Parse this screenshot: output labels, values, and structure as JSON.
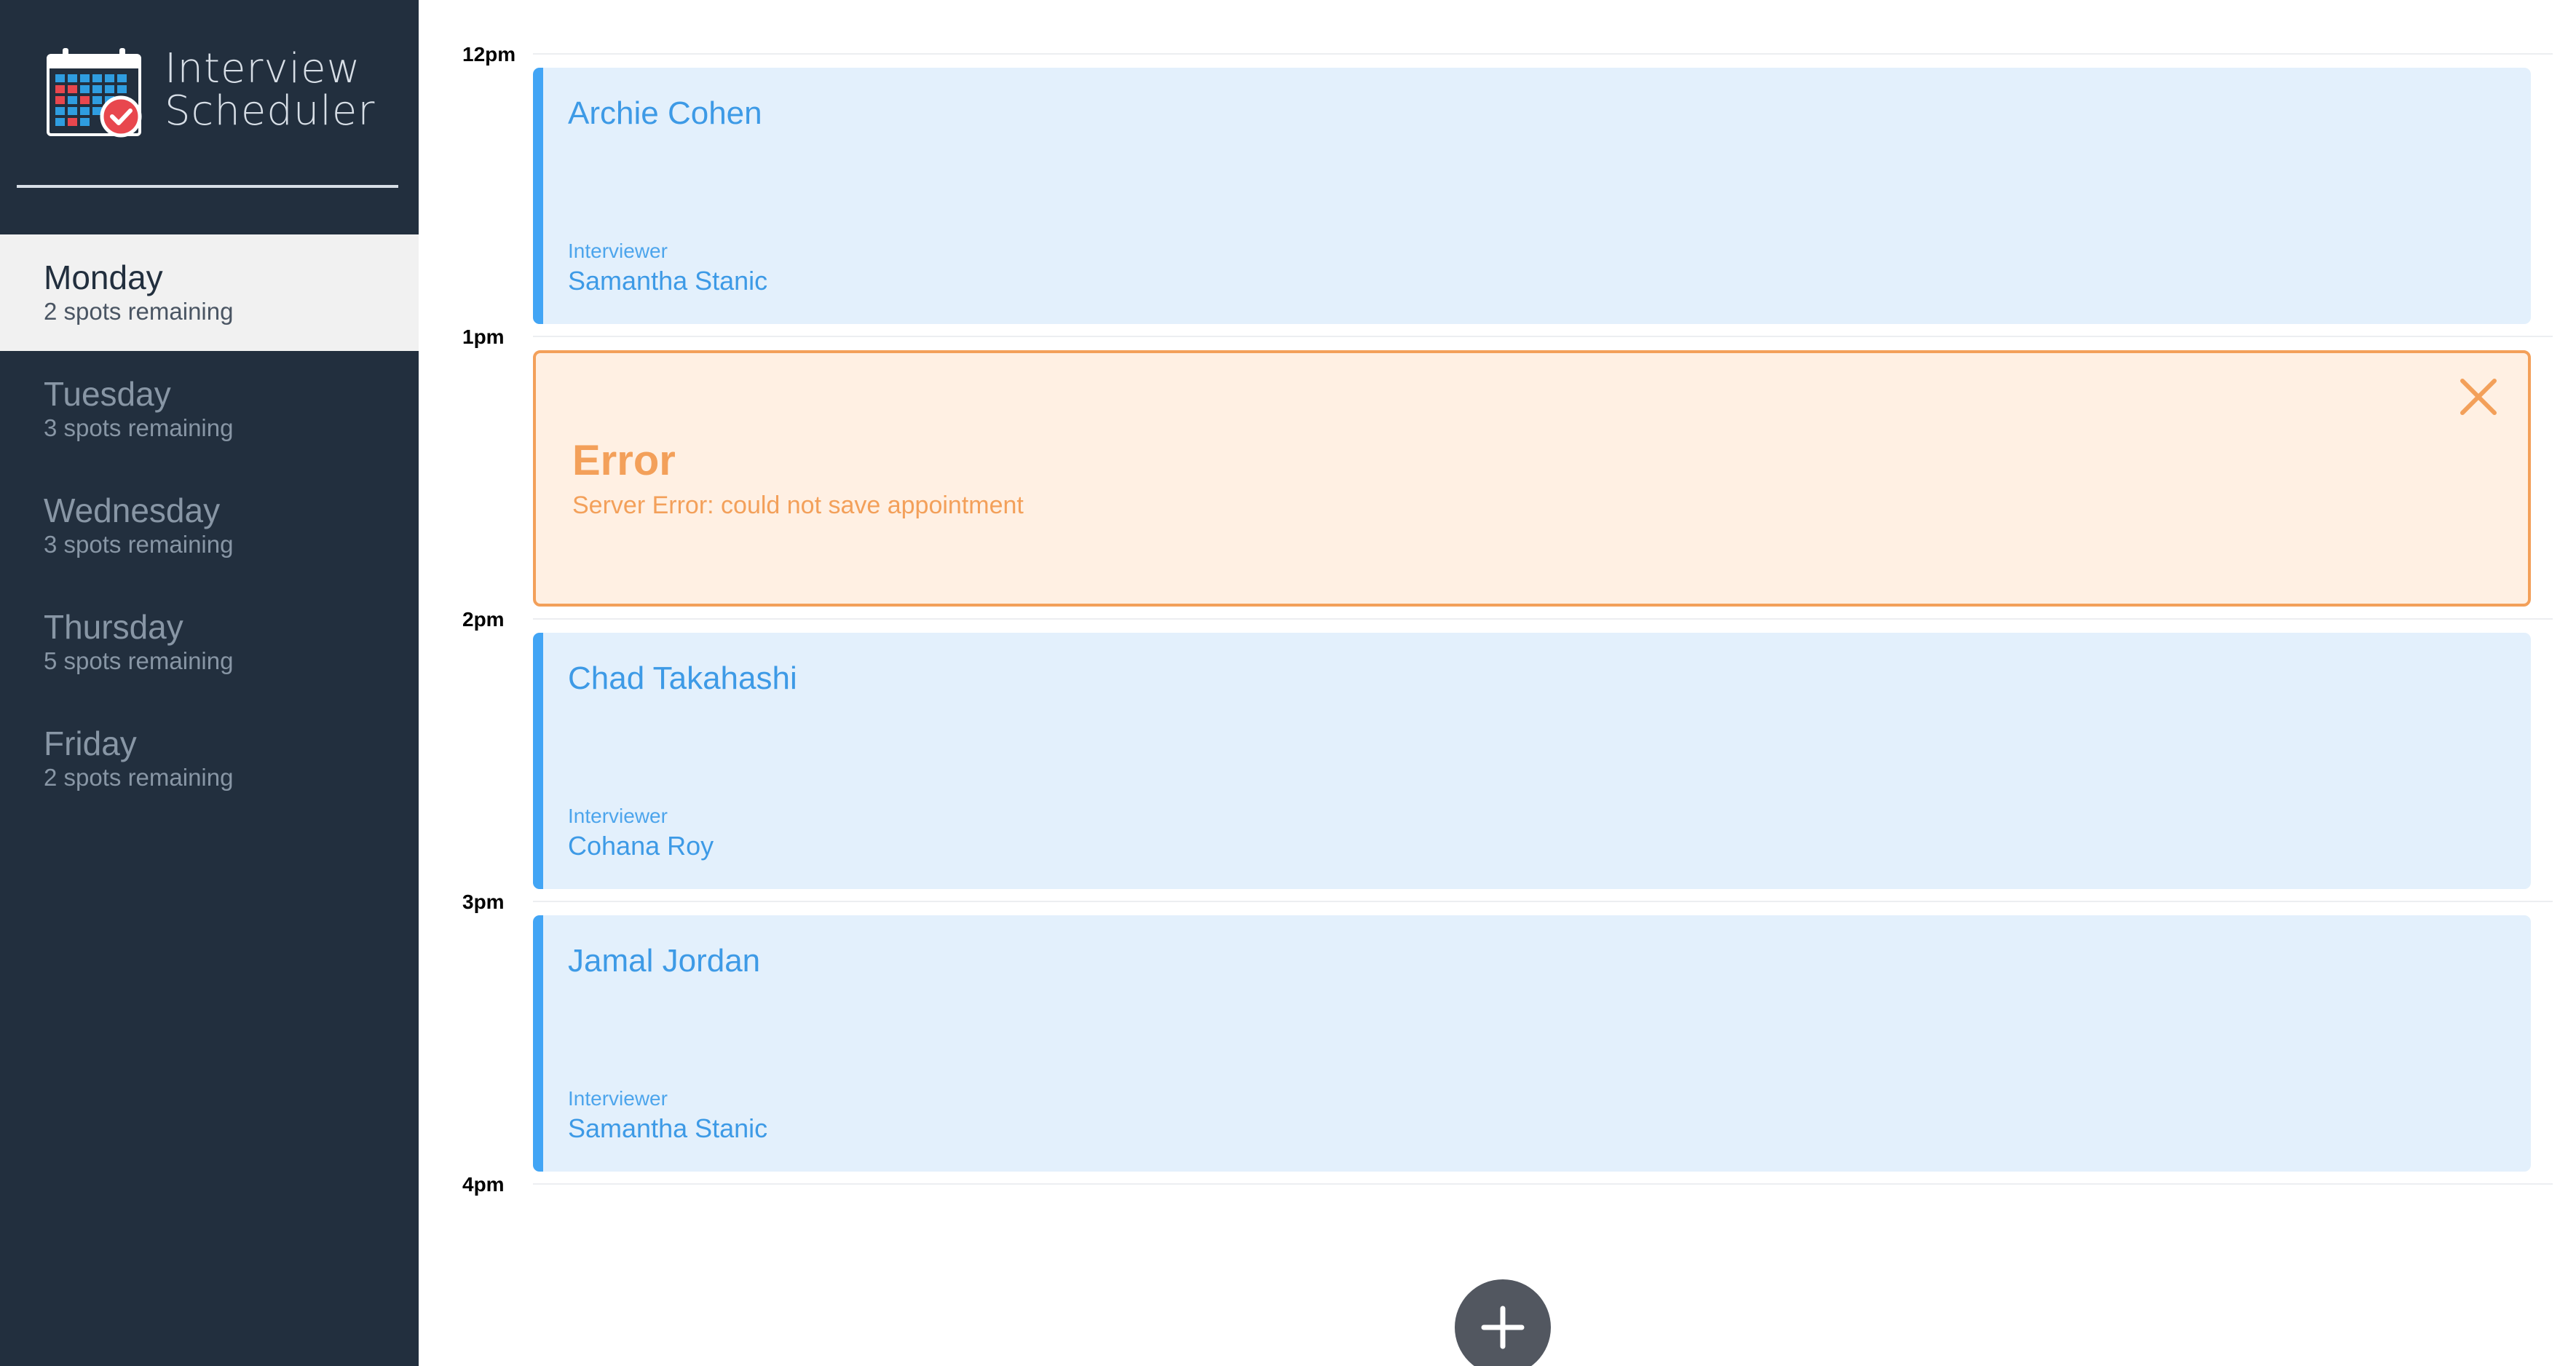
{
  "app": {
    "name_line1": "Interview",
    "name_line2": "Scheduler",
    "logo_icon": "calendar-check-icon"
  },
  "days": [
    {
      "name": "Monday",
      "spots": "2 spots remaining",
      "selected": true
    },
    {
      "name": "Tuesday",
      "spots": "3 spots remaining",
      "selected": false
    },
    {
      "name": "Wednesday",
      "spots": "3 spots remaining",
      "selected": false
    },
    {
      "name": "Thursday",
      "spots": "5 spots remaining",
      "selected": false
    },
    {
      "name": "Friday",
      "spots": "2 spots remaining",
      "selected": false
    }
  ],
  "schedule": {
    "slots": [
      {
        "time": "12pm",
        "student": "Archie Cohen",
        "interviewer_label": "Interviewer",
        "interviewer": "Samantha Stanic"
      },
      {
        "time": "1pm",
        "error": {
          "title": "Error",
          "message": "Server Error: could not save appointment",
          "close_icon": "close-icon"
        }
      },
      {
        "time": "2pm",
        "student": "Chad Takahashi",
        "interviewer_label": "Interviewer",
        "interviewer": "Cohana Roy"
      },
      {
        "time": "3pm",
        "student": "Jamal Jordan",
        "interviewer_label": "Interviewer",
        "interviewer": "Samantha Stanic"
      }
    ],
    "end_time": "4pm",
    "add_icon": "plus-icon"
  },
  "colors": {
    "sidebar_bg": "#222f3e",
    "appointment_bg": "#e3f0fc",
    "appointment_accent": "#42a5f5",
    "error_bg": "#fff0e3",
    "error_accent": "#f3a05a",
    "add_button_bg": "#525760"
  }
}
